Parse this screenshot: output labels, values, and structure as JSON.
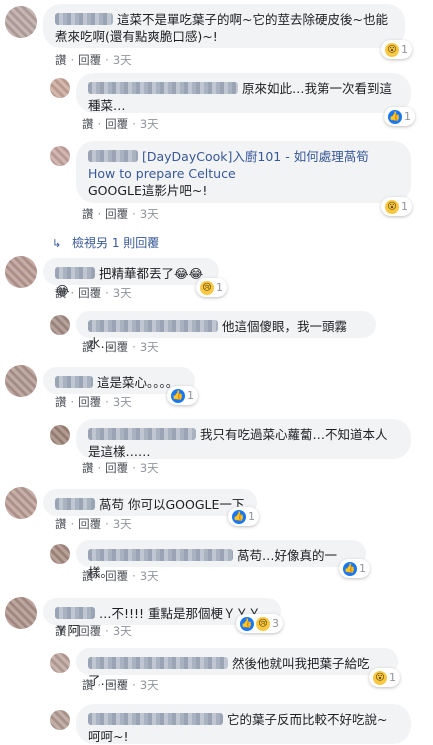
{
  "actions": {
    "like": "讚",
    "reply": "回覆",
    "sep": "·"
  },
  "reactions": {
    "like": "👍",
    "wow": "😮",
    "haha": "😆",
    "sad": "😢"
  },
  "view_more": "檢視另 1 則回覆",
  "comments": [
    {
      "text": "這菜不是單吃葉子的啊~它的莖去除硬皮後~也能煮來吃啊(還有點爽脆口感)~!",
      "time": "3天",
      "reaction_count": "1"
    },
    {
      "text": "原來如此…我第一次看到這種菜…",
      "time": "3天",
      "reaction_count": "1"
    },
    {
      "link_text": "[DayDayCook]入廚101 - 如何處理萵筍 How to prepare Celtuce",
      "text": "GOOGLE這影片吧~!",
      "time": "3天",
      "reaction_count": "1"
    },
    {
      "text": "把精華都丟了",
      "emojis": "😂😂😂",
      "time": "3天",
      "reaction_count": "1"
    },
    {
      "text": "他這個傻眼，我一頭霧水…",
      "time": "3天"
    },
    {
      "text": "這是菜心。。。。",
      "time": "3天",
      "reaction_count": "1"
    },
    {
      "text": "我只有吃過菜心蘿蔔…不知道本人是這樣……",
      "time": "3天"
    },
    {
      "text": "萵苟 你可以GOOGLE一下",
      "time": "3天",
      "reaction_count": "1"
    },
    {
      "text": "萵苟…好像真的一樣。",
      "time": "3天",
      "reaction_count": "1"
    },
    {
      "text": "…不!!!! 重點是那個梗ＹＹＹＹ阿",
      "time": "3天",
      "reaction_count": "3"
    },
    {
      "text": "然後他就叫我把葉子給吃了……",
      "time": "3天",
      "reaction_count": "1"
    },
    {
      "text": "它的葉子反而比較不好吃說~呵呵~!"
    }
  ]
}
